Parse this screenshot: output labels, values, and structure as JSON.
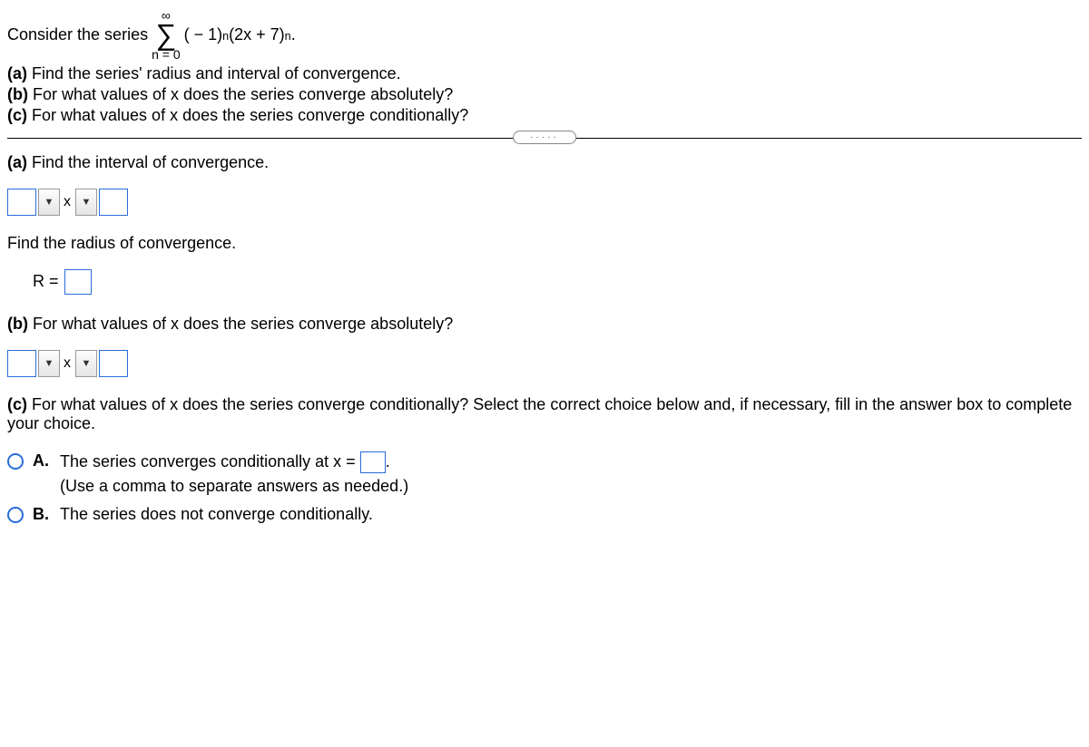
{
  "intro": {
    "prefix": "Consider the series",
    "sum_upper": "∞",
    "sum_lower": "n = 0",
    "expr_part1": "( − 1)",
    "expr_sup1": "n",
    "expr_part2": "(2x + 7)",
    "expr_sup2": "n",
    "expr_end": "."
  },
  "questions": {
    "a": "(a) Find the series' radius and interval of convergence.",
    "b": "(b) For what values of x does the series converge absolutely?",
    "c": "(c) For what values of x does the series converge conditionally?"
  },
  "partA": {
    "interval_prompt": "(a) Find the interval of convergence.",
    "x_label": "x",
    "radius_prompt": "Find the radius of convergence.",
    "r_label": "R ="
  },
  "partB": {
    "prompt": "(b) For what values of x does the series converge absolutely?",
    "x_label": "x"
  },
  "partC": {
    "prompt": "(c) For what values of x does the series converge conditionally? Select the correct choice below and, if necessary, fill in the answer box to complete your choice.",
    "optionA": {
      "label": "A.",
      "text_before": "The series converges conditionally at x =",
      "text_after": ".",
      "hint": "(Use a comma to separate answers as needed.)"
    },
    "optionB": {
      "label": "B.",
      "text": "The series does not converge conditionally."
    }
  }
}
